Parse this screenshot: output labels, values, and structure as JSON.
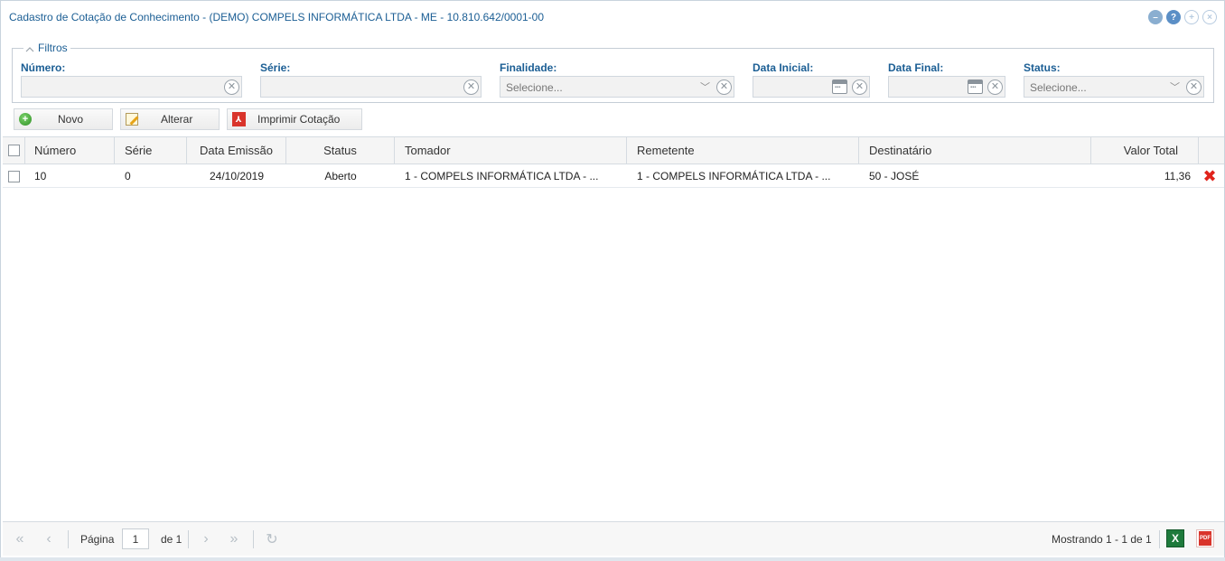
{
  "window": {
    "title": "Cadastro de Cotação de Conhecimento - (DEMO) COMPELS INFORMÁTICA LTDA - ME - 10.810.642/0001-00",
    "tools": [
      "minimize-icon",
      "help-icon",
      "maximize-icon",
      "close-icon"
    ]
  },
  "filters": {
    "legend": "Filtros",
    "numero": {
      "label": "Número:",
      "value": ""
    },
    "serie": {
      "label": "Série:",
      "value": ""
    },
    "finalidade": {
      "label": "Finalidade:",
      "value": "Selecione..."
    },
    "data_inicial": {
      "label": "Data Inicial:",
      "value": ""
    },
    "data_final": {
      "label": "Data Final:",
      "value": ""
    },
    "status": {
      "label": "Status:",
      "value": "Selecione..."
    }
  },
  "toolbar": {
    "novo": "Novo",
    "alterar": "Alterar",
    "imprimir": "Imprimir Cotação"
  },
  "grid": {
    "columns": {
      "numero": "Número",
      "serie": "Série",
      "data_emissao": "Data Emissão",
      "status": "Status",
      "tomador": "Tomador",
      "remetente": "Remetente",
      "destinatario": "Destinatário",
      "valor_total": "Valor Total"
    },
    "rows": [
      {
        "numero": "10",
        "serie": "0",
        "data_emissao": "24/10/2019",
        "status": "Aberto",
        "tomador": "1 - COMPELS INFORMÁTICA LTDA - ...",
        "remetente": "1 - COMPELS INFORMÁTICA LTDA - ...",
        "destinatario": "50 - JOSÉ",
        "valor_total": "11,36"
      }
    ]
  },
  "pager": {
    "page_label": "Página",
    "page_value": "1",
    "of_label": "de 1",
    "showing": "Mostrando 1 - 1 de 1",
    "excel_label": "X",
    "pdf_label": "PDF"
  },
  "colors": {
    "title": "#1b5e94",
    "delete": "#e0231b",
    "excel": "#1e7a3c",
    "pdf": "#d9342b"
  }
}
